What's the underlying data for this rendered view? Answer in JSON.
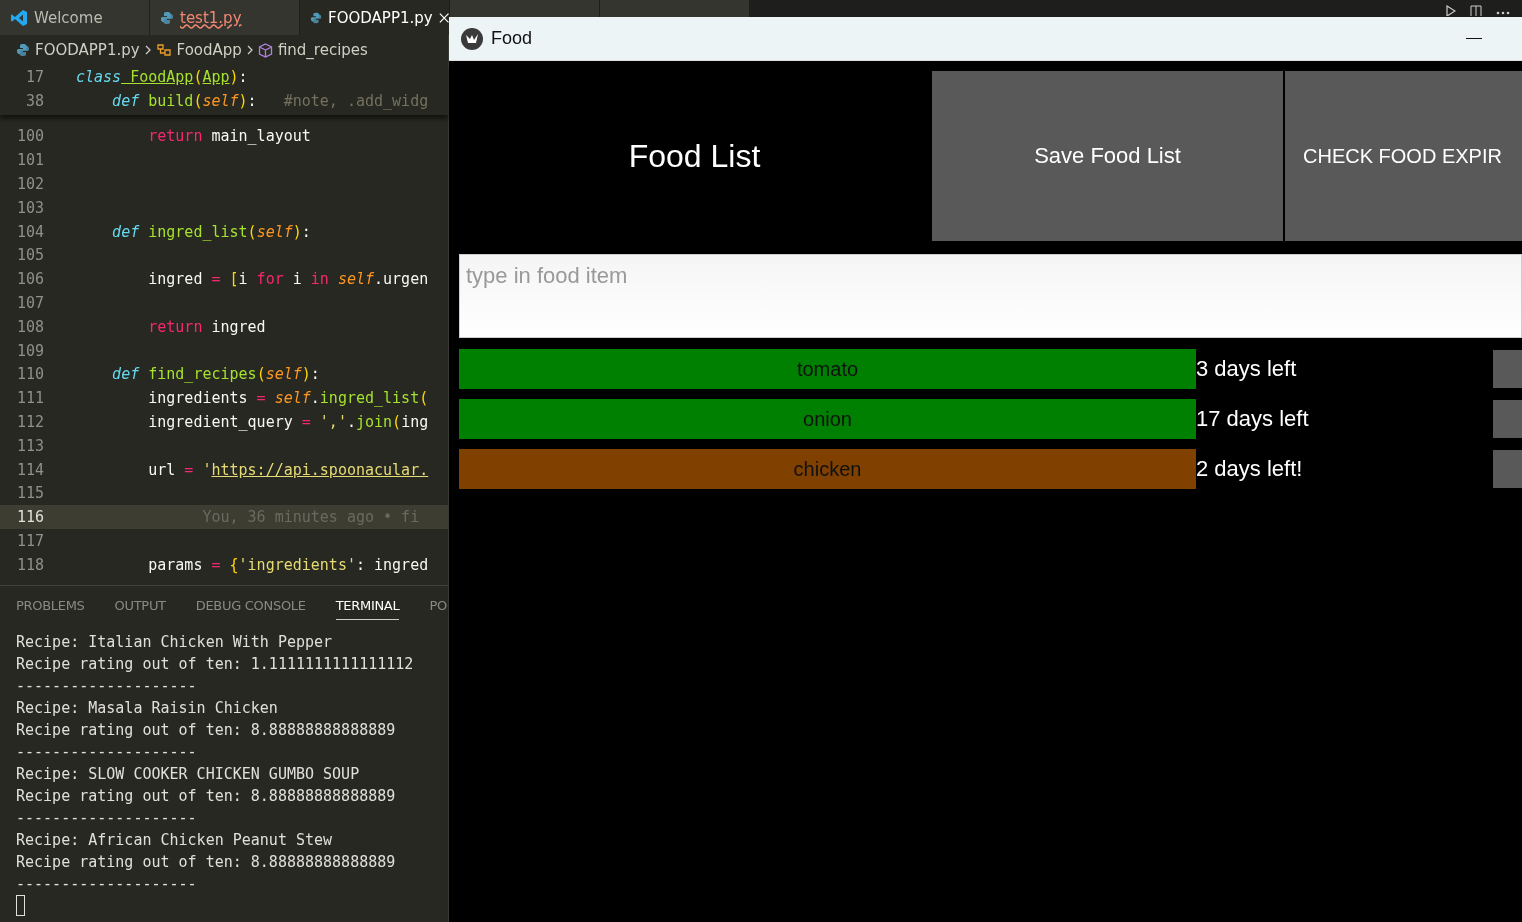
{
  "editor": {
    "tabs": [
      {
        "label": "Welcome",
        "kind": "welcome",
        "selected": false,
        "error": false
      },
      {
        "label": "test1.py",
        "kind": "python",
        "selected": false,
        "error": true
      },
      {
        "label": "FOODAPP1.py",
        "kind": "python",
        "selected": true,
        "error": false
      }
    ],
    "breadcrumbs": [
      {
        "label": "FOODAPP1.py",
        "kind": "file"
      },
      {
        "label": "FoodApp",
        "kind": "class"
      },
      {
        "label": "find_recipes",
        "kind": "method"
      }
    ],
    "sticky_lines": [
      {
        "number": "17",
        "tokens": [
          {
            "t": "class",
            "kind": "storage"
          },
          {
            "t": " FoodApp",
            "kind": "cls"
          },
          {
            "t": "(",
            "kind": "bracket"
          },
          {
            "t": "App",
            "kind": "cls"
          },
          {
            "t": ")",
            "kind": "bracket"
          },
          {
            "t": ":",
            "kind": "plain"
          }
        ]
      },
      {
        "number": "38",
        "tokens": [
          {
            "t": "    def",
            "kind": "storage"
          },
          {
            "t": " build",
            "kind": "fn"
          },
          {
            "t": "(",
            "kind": "bracket"
          },
          {
            "t": "self",
            "kind": "self"
          },
          {
            "t": ")",
            "kind": "bracket"
          },
          {
            "t": ":",
            "kind": "plain"
          },
          {
            "t": "   #note, .add_widg",
            "kind": "comment"
          }
        ]
      }
    ],
    "lines": [
      {
        "number": "100",
        "current": false,
        "tokens": [
          {
            "t": "        return",
            "kind": "kw"
          },
          {
            "t": " main_layout",
            "kind": "plain"
          }
        ]
      },
      {
        "number": "101",
        "current": false
      },
      {
        "number": "102",
        "current": false
      },
      {
        "number": "103",
        "current": false
      },
      {
        "number": "104",
        "current": false,
        "tokens": [
          {
            "t": "    def",
            "kind": "storage"
          },
          {
            "t": " ingred_list",
            "kind": "fn"
          },
          {
            "t": "(",
            "kind": "bracket"
          },
          {
            "t": "self",
            "kind": "self"
          },
          {
            "t": ")",
            "kind": "bracket"
          },
          {
            "t": ":",
            "kind": "plain"
          }
        ]
      },
      {
        "number": "105",
        "current": false
      },
      {
        "number": "106",
        "current": false,
        "tokens": [
          {
            "t": "        ingred",
            "kind": "plain"
          },
          {
            "t": " =",
            "kind": "kw"
          },
          {
            "t": " [",
            "kind": "bracket"
          },
          {
            "t": "i",
            "kind": "plain"
          },
          {
            "t": " for",
            "kind": "kw"
          },
          {
            "t": " i",
            "kind": "plain"
          },
          {
            "t": " in",
            "kind": "kw"
          },
          {
            "t": " self",
            "kind": "self"
          },
          {
            "t": ".urgen",
            "kind": "plain"
          }
        ]
      },
      {
        "number": "107",
        "current": false
      },
      {
        "number": "108",
        "current": false,
        "tokens": [
          {
            "t": "        return",
            "kind": "kw"
          },
          {
            "t": " ingred",
            "kind": "plain"
          }
        ]
      },
      {
        "number": "109",
        "current": false
      },
      {
        "number": "110",
        "current": false,
        "tokens": [
          {
            "t": "    def",
            "kind": "storage"
          },
          {
            "t": " find_recipes",
            "kind": "fn"
          },
          {
            "t": "(",
            "kind": "bracket"
          },
          {
            "t": "self",
            "kind": "self"
          },
          {
            "t": ")",
            "kind": "bracket"
          },
          {
            "t": ":",
            "kind": "plain"
          }
        ]
      },
      {
        "number": "111",
        "current": false,
        "tokens": [
          {
            "t": "        ingredients",
            "kind": "plain"
          },
          {
            "t": " =",
            "kind": "kw"
          },
          {
            "t": " self",
            "kind": "self"
          },
          {
            "t": ".",
            "kind": "plain"
          },
          {
            "t": "ingred_list",
            "kind": "fn"
          },
          {
            "t": "(",
            "kind": "bracket"
          }
        ]
      },
      {
        "number": "112",
        "current": false,
        "tokens": [
          {
            "t": "        ingredient_query",
            "kind": "plain"
          },
          {
            "t": " =",
            "kind": "kw"
          },
          {
            "t": " ','",
            "kind": "str"
          },
          {
            "t": ".",
            "kind": "plain"
          },
          {
            "t": "join",
            "kind": "fn"
          },
          {
            "t": "(",
            "kind": "bracket"
          },
          {
            "t": "ing",
            "kind": "plain"
          }
        ]
      },
      {
        "number": "113",
        "current": false
      },
      {
        "number": "114",
        "current": false,
        "tokens": [
          {
            "t": "        url",
            "kind": "plain"
          },
          {
            "t": " =",
            "kind": "kw"
          },
          {
            "t": " '",
            "kind": "str"
          },
          {
            "t": "https://api.spoonacular.",
            "kind": "link"
          }
        ]
      },
      {
        "number": "115",
        "current": false
      },
      {
        "number": "116",
        "current": true,
        "tokens": [
          {
            "t": "              You, 36 minutes ago • fi",
            "kind": "blame"
          }
        ]
      },
      {
        "number": "117",
        "current": false
      },
      {
        "number": "118",
        "current": false,
        "tokens": [
          {
            "t": "        params",
            "kind": "plain"
          },
          {
            "t": " =",
            "kind": "kw"
          },
          {
            "t": " {",
            "kind": "bracket"
          },
          {
            "t": "'ingredients'",
            "kind": "str"
          },
          {
            "t": ": ingred",
            "kind": "plain"
          }
        ]
      }
    ]
  },
  "panel": {
    "tabs": [
      {
        "label": "PROBLEMS",
        "selected": false
      },
      {
        "label": "OUTPUT",
        "selected": false
      },
      {
        "label": "DEBUG CONSOLE",
        "selected": false
      },
      {
        "label": "TERMINAL",
        "selected": true
      },
      {
        "label": "PO",
        "selected": false
      }
    ],
    "terminal_lines": [
      "Recipe: Italian Chicken With Pepper",
      "Recipe rating out of ten: 1.1111111111111112",
      "--------------------",
      "Recipe: Masala Raisin Chicken",
      "Recipe rating out of ten: 8.88888888888889",
      "--------------------",
      "Recipe: SLOW COOKER CHICKEN GUMBO SOUP",
      "Recipe rating out of ten: 8.88888888888889",
      "--------------------",
      "Recipe: African Chicken Peanut Stew",
      "Recipe rating out of ten: 8.88888888888889",
      "--------------------"
    ]
  },
  "app_window": {
    "title": "Food",
    "heading": "Food List",
    "buttons": [
      "Save Food List",
      "CHECK FOOD EXPIR"
    ],
    "input": {
      "placeholder": "type in food item"
    },
    "items": [
      {
        "name": "tomato",
        "days": "3 days left",
        "color": "#008000"
      },
      {
        "name": "onion",
        "days": "17 days left",
        "color": "#008000"
      },
      {
        "name": "chicken",
        "days": "2 days left!",
        "color": "#804000"
      }
    ]
  }
}
